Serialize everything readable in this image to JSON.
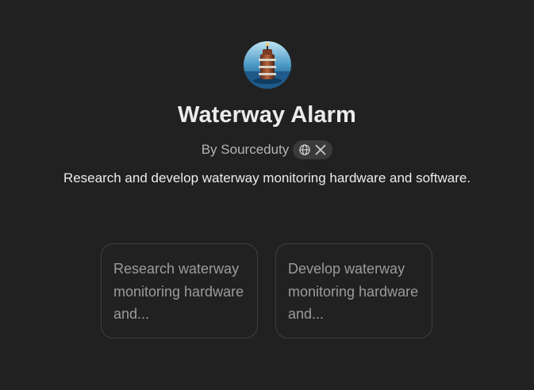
{
  "gpt": {
    "name": "Waterway Alarm",
    "author": "By Sourceduty",
    "description": "Research and develop waterway monitoring hardware and software.",
    "avatar_icon": "buoy-tower-avatar",
    "social_icons": [
      "globe-icon",
      "x-logo-icon"
    ]
  },
  "conversation_starters": [
    {
      "label": "Research waterway monitoring hardware and..."
    },
    {
      "label": "Develop waterway monitoring hardware and..."
    }
  ],
  "colors": {
    "background": "#212121",
    "title": "#ececec",
    "muted": "#b4b4b4",
    "starter_text": "#9b9b9b",
    "starter_border": "#3f3f3f",
    "pill": "#3a3a3a"
  }
}
